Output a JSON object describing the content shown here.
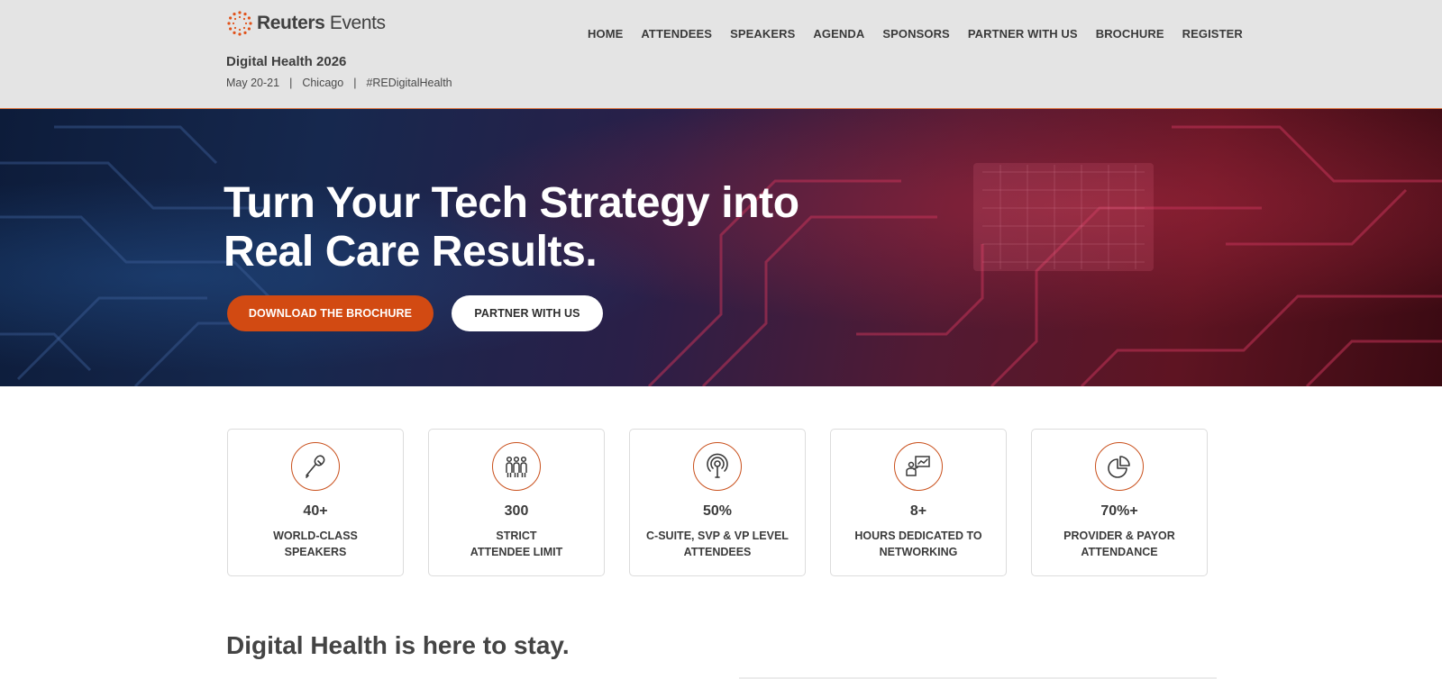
{
  "header": {
    "logo": {
      "brand": "Reuters",
      "sub": "Events"
    },
    "event_title": "Digital Health 2026",
    "meta": [
      "May 20-21",
      "|",
      "Chicago",
      "|",
      "#REDigitalHealth"
    ]
  },
  "nav": [
    "HOME",
    "ATTENDEES",
    "SPEAKERS",
    "AGENDA",
    "SPONSORS",
    "PARTNER WITH US",
    "BROCHURE",
    "REGISTER"
  ],
  "hero": {
    "title_line1": "Turn Your Tech Strategy into",
    "title_line2": "Real Care Results.",
    "primary_button": "DOWNLOAD THE BROCHURE",
    "secondary_button": "PARTNER WITH US"
  },
  "stats": [
    {
      "icon": "microphone-icon",
      "value": "40+",
      "label": "WORLD-CLASS\nSPEAKERS"
    },
    {
      "icon": "people-group-icon",
      "value": "300",
      "label": "STRICT\nATTENDEE LIMIT"
    },
    {
      "icon": "podcast-icon",
      "value": "50%",
      "label": "C-SUITE, SVP & VP LEVEL\nATTENDEES"
    },
    {
      "icon": "presenter-chart-icon",
      "value": "8+",
      "label": "HOURS DEDICATED TO\nNETWORKING"
    },
    {
      "icon": "pie-chart-icon",
      "value": "70%+",
      "label": "PROVIDER & PAYOR\nATTENDANCE"
    }
  ],
  "section": {
    "title": "Digital Health is here to stay."
  },
  "colors": {
    "accent": "#d24a12",
    "header_bg": "#e4e4e4",
    "icon_ring": "#c9501c"
  }
}
